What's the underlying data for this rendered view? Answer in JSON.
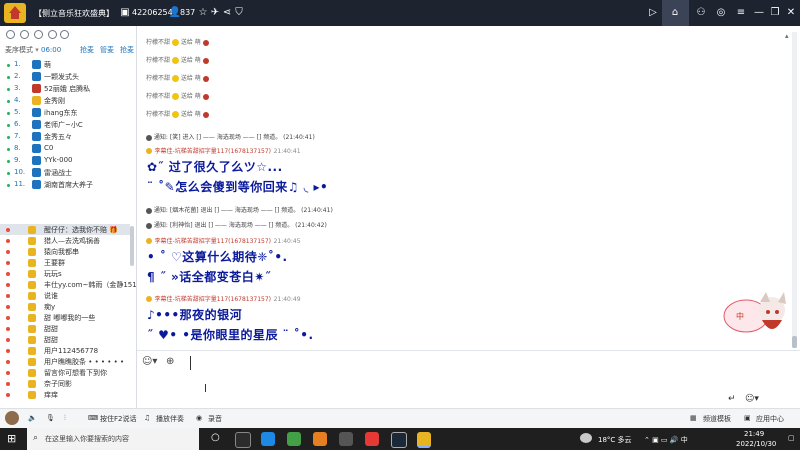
{
  "titlebar": {
    "room_title": "【侧立音乐狂欢盛典】",
    "room_id": "42206254",
    "user_count": "837"
  },
  "left_panel": {
    "mode_label": "麦序模式",
    "mode_time": "06:00",
    "link1": "抢麦",
    "link2": "管麦",
    "link3": "抢麦",
    "queue": [
      {
        "num": "1.",
        "name": "萌",
        "color": "#1e73be"
      },
      {
        "num": "2.",
        "name": "一颗发式头",
        "color": "#1e73be"
      },
      {
        "num": "3.",
        "name": "52丽娥 启腾私",
        "color": "#c0392b"
      },
      {
        "num": "4.",
        "name": "金秀刚",
        "color": "#e8b422"
      },
      {
        "num": "5.",
        "name": "ihang东东",
        "color": "#1e73be"
      },
      {
        "num": "6.",
        "name": "老师广~小C",
        "color": "#1e73be"
      },
      {
        "num": "7.",
        "name": "金秀五々",
        "color": "#1e73be"
      },
      {
        "num": "8.",
        "name": "C0",
        "color": "#1e73be"
      },
      {
        "num": "9.",
        "name": "YYk-000",
        "color": "#1e73be"
      },
      {
        "num": "10.",
        "name": "雷涵战士",
        "color": "#1e73be"
      },
      {
        "num": "11.",
        "name": "湖南首席大养子",
        "color": "#1e73be"
      }
    ],
    "users": [
      {
        "name": "醒仔仔：选我你不赔 🎁",
        "highlight": true
      },
      {
        "name": "猎人—去洗鸡锅善"
      },
      {
        "name": "猿向我都串"
      },
      {
        "name": "王要群"
      },
      {
        "name": "玩玩s"
      },
      {
        "name": "丰仕yy.com~韩雨（金静1517000"
      },
      {
        "name": "说谁"
      },
      {
        "name": "痴y"
      },
      {
        "name": "甜 嘟嘟我的一些"
      },
      {
        "name": "甜甜"
      },
      {
        "name": "甜甜"
      },
      {
        "name": "用户112456778"
      },
      {
        "name": "用户瞧瞧胶条 • • • • • •"
      },
      {
        "name": "留言你可想看下到你"
      },
      {
        "name": "奈子同影"
      },
      {
        "name": "痒痒"
      }
    ]
  },
  "chat": {
    "lines": [
      {
        "type": "small",
        "text": "柠檬不甜",
        "extra": "送给 萌"
      },
      {
        "type": "small",
        "text": "柠檬不甜",
        "extra": "送给 萌"
      },
      {
        "type": "small",
        "text": "柠檬不甜",
        "extra": "送给 萌"
      },
      {
        "type": "small",
        "text": "柠檬不甜",
        "extra": "送给 萌"
      },
      {
        "type": "small",
        "text": "柠檬不甜",
        "extra": "送给 萌"
      }
    ],
    "sys1": "通知: [笑] 进入 [] —— 海选现场 —— [] 频道。 (21:40:41)",
    "msg1_name": "李幕佳-坑梯苦甜招字量117(1678137157)",
    "msg1_time": "21:40:41",
    "msg1_line1": "✿˝ 过了很久了么ツ☆...",
    "msg1_line2": "¨ ˚✎怎么会傻到等你回来♫ ◟ ▸•",
    "sys2": "通知: [烟木花菌] 退出 [] —— 海选现场 —— [] 频道。 (21:40:41)",
    "sys3": "通知: [利神怡] 退出 [] —— 海选现场 —— [] 频道。 (21:40:42)",
    "msg2_name": "李幕佳-坑梯苦甜招字量117(1678137157)",
    "msg2_time": "21:40:45",
    "msg2_line1": "• ˚ ♡这算什么期待❈˚•.",
    "msg2_line2": "¶ ˝ »话全都变苍白✷˝",
    "msg3_name": "李幕佳-坑梯苦甜招字量117(1678137157)",
    "msg3_time": "21:40:49",
    "msg3_line1": "♪•••那夜的银河",
    "msg3_line2": "˝ ♥• •是你眼里的星辰 ¨ ˚•."
  },
  "bottombar": {
    "mic_label": "按住F2说话",
    "accompany_label": "播放伴奏",
    "record_label": "录音",
    "channel_mode": "频道模板",
    "apply_label": "应用中心"
  },
  "taskbar": {
    "search_placeholder": "在这里输入你要搜索的内容",
    "weather": "18°C 多云",
    "clock_time": "21:49",
    "clock_date": "2022/10/30"
  }
}
